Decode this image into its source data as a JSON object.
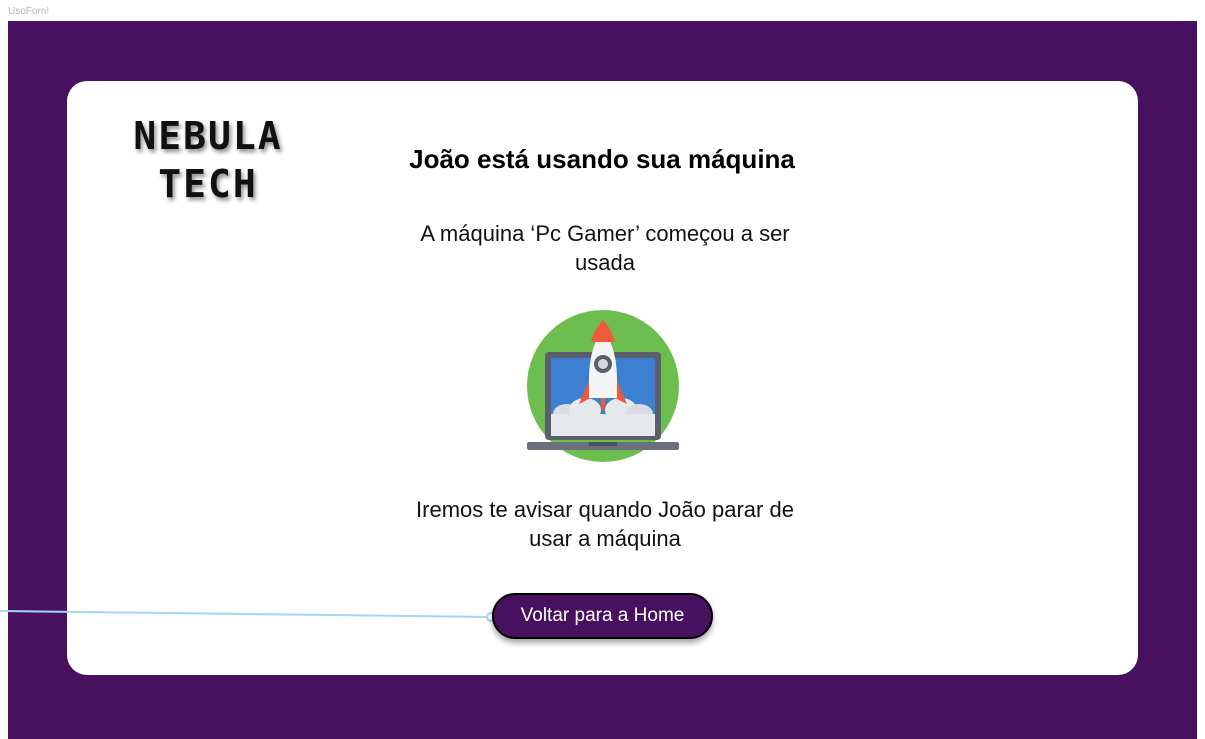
{
  "frame": {
    "label": "UsoForn!"
  },
  "logo": {
    "line1": "NEBULA",
    "line2": "TECH"
  },
  "page": {
    "title": "João está usando sua máquina",
    "message_started": "A máquina ‘Pc Gamer’ começou a ser usada",
    "message_notify": "Iremos te avisar quando João parar de usar a máquina"
  },
  "illustration": {
    "icon": "rocket-laptop-icon"
  },
  "actions": {
    "home_button_label": "Voltar para a Home"
  },
  "colors": {
    "frame_background": "#47115f",
    "card_background": "#ffffff",
    "button_background": "#47115f",
    "connector_line": "#a6d4f5"
  }
}
